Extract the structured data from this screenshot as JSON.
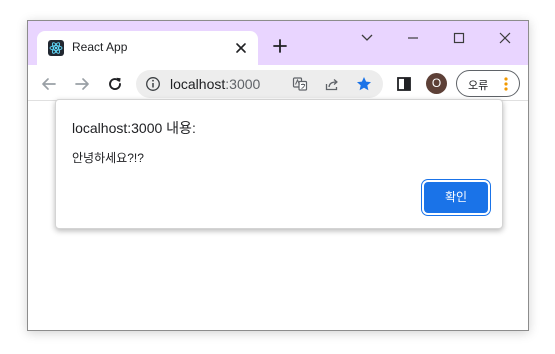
{
  "tab": {
    "title": "React App",
    "favicon": "react-logo-icon"
  },
  "window_controls": {
    "tab_search": "chevron-down-icon",
    "minimize": "minimize-icon",
    "maximize": "maximize-icon",
    "close": "close-icon"
  },
  "address_bar": {
    "host": "localhost",
    "port": ":3000"
  },
  "toolbar": {
    "profile_initial": "O",
    "error_button_label": "오류"
  },
  "dialog": {
    "title": "localhost:3000 내용:",
    "message": "안녕하세요?!?",
    "ok_label": "확인"
  },
  "colors": {
    "titlebar": "#e9d5ff",
    "accent_blue": "#1a73e8",
    "avatar": "#5d4037",
    "menu_dots": "#f29900"
  }
}
